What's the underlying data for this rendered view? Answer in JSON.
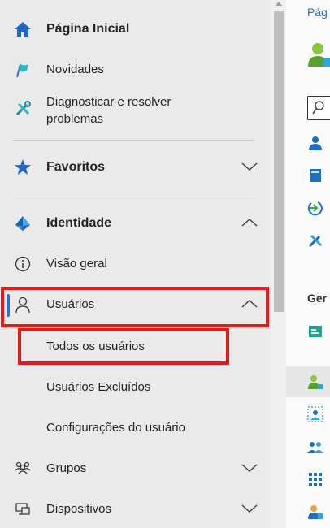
{
  "nav": {
    "home": "Página Inicial",
    "news": "Novidades",
    "diagnose_line1": "Diagnosticar e resolver",
    "diagnose_line2": "problemas",
    "favorites": "Favoritos",
    "identity": "Identidade",
    "overview": "Visão geral",
    "users": "Usuários",
    "users_sub": [
      "Todos os usuários",
      "Usuários Excluídos",
      "Configurações do usuário"
    ],
    "groups": "Grupos",
    "devices": "Dispositivos"
  },
  "content": {
    "breadcrumb": "Pág",
    "section": "Ger"
  },
  "colors": {
    "nav_bg": "#eaeaea",
    "accent_blue": "#2f6fd1",
    "highlight_red": "#e31b1b"
  }
}
